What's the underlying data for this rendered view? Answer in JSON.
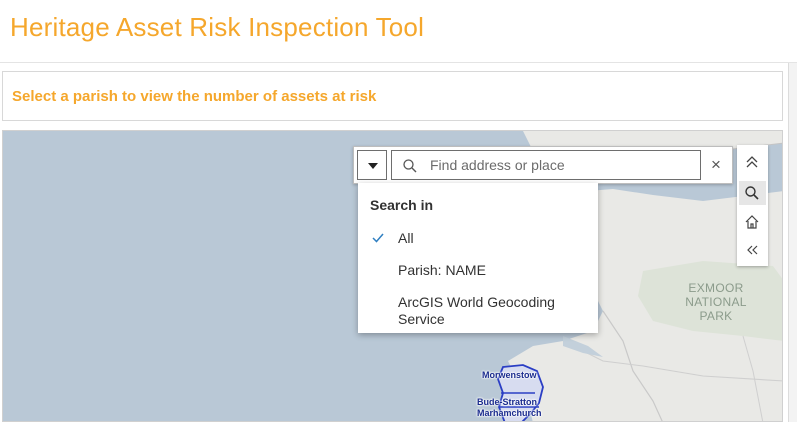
{
  "header": {
    "title": "Heritage Asset Risk Inspection Tool"
  },
  "instruction": {
    "text": "Select a parish to view the number of assets at risk"
  },
  "search": {
    "placeholder": "Find address or place",
    "value": "",
    "clear_symbol": "×"
  },
  "search_sources": {
    "heading": "Search in",
    "items": [
      {
        "label": "All",
        "selected": true
      },
      {
        "label": "Parish: NAME",
        "selected": false
      },
      {
        "label": "ArcGIS World Geocoding Service",
        "selected": false
      }
    ]
  },
  "widgets": [
    {
      "icon": "collapse-up-icon"
    },
    {
      "icon": "search-icon",
      "active": true
    },
    {
      "icon": "home-icon"
    },
    {
      "icon": "expand-left-icon"
    }
  ],
  "map": {
    "labels": {
      "exmoor": "EXMOOR\nNATIONAL PARK"
    },
    "parishes": [
      "Morwenstow",
      "Bude-Stratton",
      "Marhamchurch"
    ]
  },
  "colors": {
    "accent": "#f5a72c",
    "water": "#b9c8d6",
    "land": "#e9e9e6",
    "parish_outline": "#2b3ec4"
  }
}
